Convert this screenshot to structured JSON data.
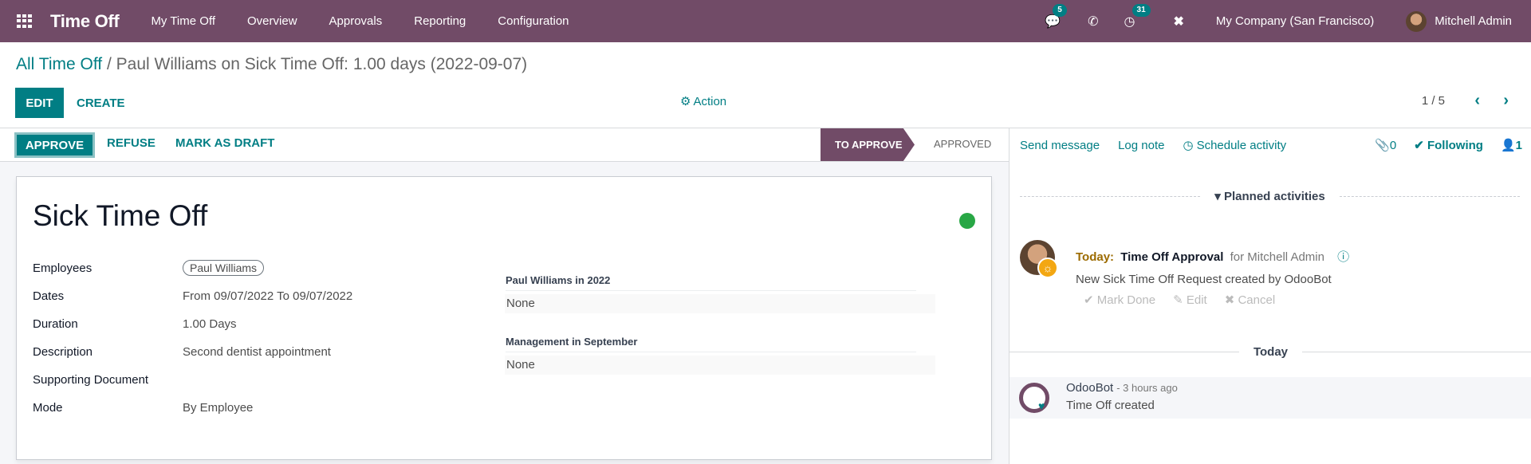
{
  "navbar": {
    "app_title": "Time Off",
    "menu": [
      "My Time Off",
      "Overview",
      "Approvals",
      "Reporting",
      "Configuration"
    ],
    "messages_badge": "5",
    "activities_badge": "31",
    "company": "My Company (San Francisco)",
    "user": "Mitchell Admin"
  },
  "control": {
    "breadcrumb_parent": "All Time Off",
    "breadcrumb_separator": " / ",
    "breadcrumb_current": "Paul Williams on Sick Time Off: 1.00 days (2022-09-07)",
    "edit_label": "EDIT",
    "create_label": "CREATE",
    "action_label": "Action",
    "pager": "1 / 5"
  },
  "statusbar": {
    "approve_label": "APPROVE",
    "refuse_label": "REFUSE",
    "draft_label": "MARK AS DRAFT",
    "stages": [
      "TO APPROVE",
      "APPROVED"
    ],
    "current_stage": "TO APPROVE"
  },
  "form": {
    "title": "Sick Time Off",
    "status_color": "#28a745",
    "fields": [
      {
        "label": "Employees",
        "value": "Paul Williams"
      },
      {
        "label": "Dates",
        "value": "From 09/07/2022 To 09/07/2022"
      },
      {
        "label": "Duration",
        "value": "1.00 Days"
      },
      {
        "label": "Description",
        "value": "Second dentist appointment"
      },
      {
        "label": "Supporting Document",
        "value": ""
      },
      {
        "label": "Mode",
        "value": "By Employee"
      }
    ],
    "side_sections": [
      {
        "label": "Paul Williams in 2022",
        "value": "None"
      },
      {
        "label": "Management in September",
        "value": "None"
      }
    ]
  },
  "chatter": {
    "send_message": "Send message",
    "log_note": "Log note",
    "schedule_activity": "Schedule activity",
    "attachments_count": "0",
    "following_label": "Following",
    "followers_count": "1",
    "planned_label": "Planned activities",
    "activity": {
      "due": "Today:",
      "type": "Time Off Approval",
      "assignee": "for Mitchell Admin",
      "summary": "New Sick Time Off Request created by OdooBot",
      "mark_done": "Mark Done",
      "edit": "Edit",
      "cancel": "Cancel"
    },
    "date_separator": "Today",
    "message": {
      "author": "OdooBot",
      "time": "- 3 hours ago",
      "body": "Time Off created"
    }
  },
  "colors": {
    "brand": "#714b67",
    "accent": "#017e84",
    "activity_badge": "#f3a712"
  }
}
